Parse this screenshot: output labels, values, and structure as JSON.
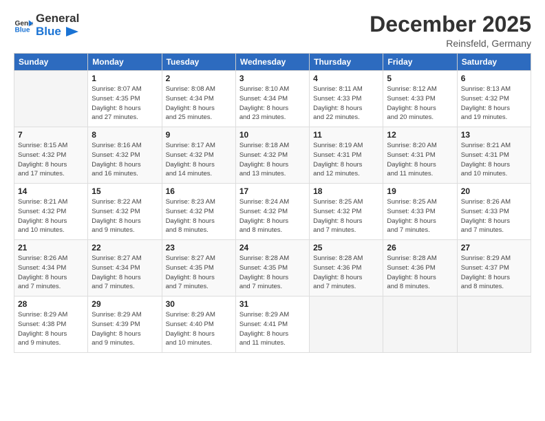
{
  "header": {
    "logo_general": "General",
    "logo_blue": "Blue",
    "month": "December 2025",
    "location": "Reinsfeld, Germany"
  },
  "days_of_week": [
    "Sunday",
    "Monday",
    "Tuesday",
    "Wednesday",
    "Thursday",
    "Friday",
    "Saturday"
  ],
  "weeks": [
    [
      {
        "day": "",
        "info": ""
      },
      {
        "day": "1",
        "info": "Sunrise: 8:07 AM\nSunset: 4:35 PM\nDaylight: 8 hours\nand 27 minutes."
      },
      {
        "day": "2",
        "info": "Sunrise: 8:08 AM\nSunset: 4:34 PM\nDaylight: 8 hours\nand 25 minutes."
      },
      {
        "day": "3",
        "info": "Sunrise: 8:10 AM\nSunset: 4:34 PM\nDaylight: 8 hours\nand 23 minutes."
      },
      {
        "day": "4",
        "info": "Sunrise: 8:11 AM\nSunset: 4:33 PM\nDaylight: 8 hours\nand 22 minutes."
      },
      {
        "day": "5",
        "info": "Sunrise: 8:12 AM\nSunset: 4:33 PM\nDaylight: 8 hours\nand 20 minutes."
      },
      {
        "day": "6",
        "info": "Sunrise: 8:13 AM\nSunset: 4:32 PM\nDaylight: 8 hours\nand 19 minutes."
      }
    ],
    [
      {
        "day": "7",
        "info": "Sunrise: 8:15 AM\nSunset: 4:32 PM\nDaylight: 8 hours\nand 17 minutes."
      },
      {
        "day": "8",
        "info": "Sunrise: 8:16 AM\nSunset: 4:32 PM\nDaylight: 8 hours\nand 16 minutes."
      },
      {
        "day": "9",
        "info": "Sunrise: 8:17 AM\nSunset: 4:32 PM\nDaylight: 8 hours\nand 14 minutes."
      },
      {
        "day": "10",
        "info": "Sunrise: 8:18 AM\nSunset: 4:32 PM\nDaylight: 8 hours\nand 13 minutes."
      },
      {
        "day": "11",
        "info": "Sunrise: 8:19 AM\nSunset: 4:31 PM\nDaylight: 8 hours\nand 12 minutes."
      },
      {
        "day": "12",
        "info": "Sunrise: 8:20 AM\nSunset: 4:31 PM\nDaylight: 8 hours\nand 11 minutes."
      },
      {
        "day": "13",
        "info": "Sunrise: 8:21 AM\nSunset: 4:31 PM\nDaylight: 8 hours\nand 10 minutes."
      }
    ],
    [
      {
        "day": "14",
        "info": "Sunrise: 8:21 AM\nSunset: 4:32 PM\nDaylight: 8 hours\nand 10 minutes."
      },
      {
        "day": "15",
        "info": "Sunrise: 8:22 AM\nSunset: 4:32 PM\nDaylight: 8 hours\nand 9 minutes."
      },
      {
        "day": "16",
        "info": "Sunrise: 8:23 AM\nSunset: 4:32 PM\nDaylight: 8 hours\nand 8 minutes."
      },
      {
        "day": "17",
        "info": "Sunrise: 8:24 AM\nSunset: 4:32 PM\nDaylight: 8 hours\nand 8 minutes."
      },
      {
        "day": "18",
        "info": "Sunrise: 8:25 AM\nSunset: 4:32 PM\nDaylight: 8 hours\nand 7 minutes."
      },
      {
        "day": "19",
        "info": "Sunrise: 8:25 AM\nSunset: 4:33 PM\nDaylight: 8 hours\nand 7 minutes."
      },
      {
        "day": "20",
        "info": "Sunrise: 8:26 AM\nSunset: 4:33 PM\nDaylight: 8 hours\nand 7 minutes."
      }
    ],
    [
      {
        "day": "21",
        "info": "Sunrise: 8:26 AM\nSunset: 4:34 PM\nDaylight: 8 hours\nand 7 minutes."
      },
      {
        "day": "22",
        "info": "Sunrise: 8:27 AM\nSunset: 4:34 PM\nDaylight: 8 hours\nand 7 minutes."
      },
      {
        "day": "23",
        "info": "Sunrise: 8:27 AM\nSunset: 4:35 PM\nDaylight: 8 hours\nand 7 minutes."
      },
      {
        "day": "24",
        "info": "Sunrise: 8:28 AM\nSunset: 4:35 PM\nDaylight: 8 hours\nand 7 minutes."
      },
      {
        "day": "25",
        "info": "Sunrise: 8:28 AM\nSunset: 4:36 PM\nDaylight: 8 hours\nand 7 minutes."
      },
      {
        "day": "26",
        "info": "Sunrise: 8:28 AM\nSunset: 4:36 PM\nDaylight: 8 hours\nand 8 minutes."
      },
      {
        "day": "27",
        "info": "Sunrise: 8:29 AM\nSunset: 4:37 PM\nDaylight: 8 hours\nand 8 minutes."
      }
    ],
    [
      {
        "day": "28",
        "info": "Sunrise: 8:29 AM\nSunset: 4:38 PM\nDaylight: 8 hours\nand 9 minutes."
      },
      {
        "day": "29",
        "info": "Sunrise: 8:29 AM\nSunset: 4:39 PM\nDaylight: 8 hours\nand 9 minutes."
      },
      {
        "day": "30",
        "info": "Sunrise: 8:29 AM\nSunset: 4:40 PM\nDaylight: 8 hours\nand 10 minutes."
      },
      {
        "day": "31",
        "info": "Sunrise: 8:29 AM\nSunset: 4:41 PM\nDaylight: 8 hours\nand 11 minutes."
      },
      {
        "day": "",
        "info": ""
      },
      {
        "day": "",
        "info": ""
      },
      {
        "day": "",
        "info": ""
      }
    ]
  ]
}
